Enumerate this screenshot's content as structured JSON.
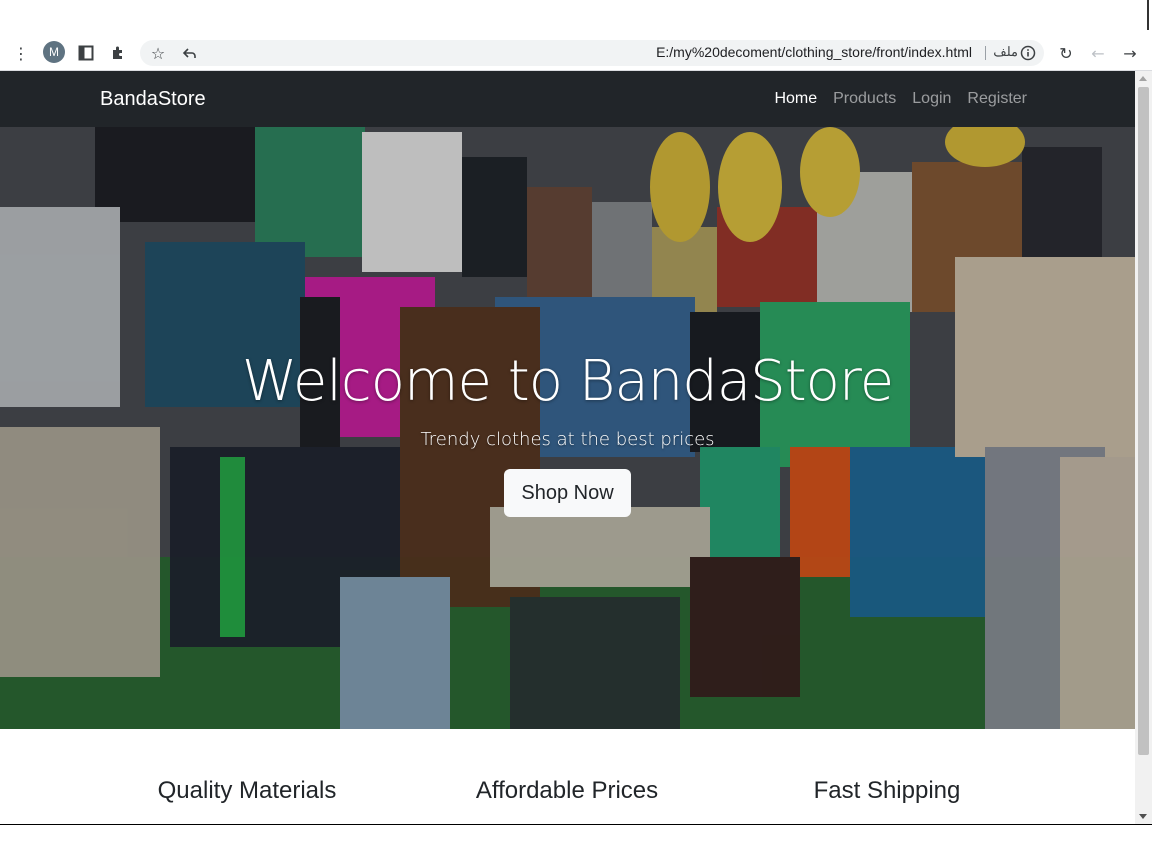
{
  "browser": {
    "avatar_letter": "M",
    "url": "E:/my%20decoment/clothing_store/front/index.html",
    "site_label": "ملف",
    "icons": [
      "menu-dots-icon",
      "sidebar-icon",
      "extensions-icon",
      "star-icon",
      "share-icon",
      "info-icon",
      "reload-icon",
      "back-icon",
      "forward-icon"
    ]
  },
  "navbar": {
    "brand": "BandaStore",
    "links": [
      {
        "label": "Home",
        "active": true
      },
      {
        "label": "Products",
        "active": false
      },
      {
        "label": "Login",
        "active": false
      },
      {
        "label": "Register",
        "active": false
      }
    ],
    "bg_color": "#212529"
  },
  "hero": {
    "title": "Welcome to BandaStore",
    "subtitle": "Trendy clothes at the best prices",
    "button_label": "Shop Now"
  },
  "features": [
    {
      "title": "Quality Materials",
      "text": ""
    },
    {
      "title": "Affordable Prices",
      "text": ""
    },
    {
      "title": "Fast Shipping",
      "text": ""
    }
  ]
}
